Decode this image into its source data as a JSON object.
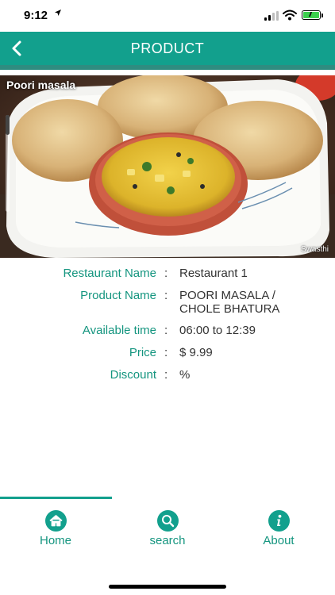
{
  "status_bar": {
    "time": "9:12",
    "location_icon": "location-arrow-icon",
    "signal_icon": "cellular-signal-icon",
    "wifi_icon": "wifi-icon",
    "battery_icon": "battery-charging-icon"
  },
  "header": {
    "title": "PRODUCT",
    "back_icon": "chevron-left-icon"
  },
  "product_image": {
    "overlay_title": "Poori masala",
    "watermark": "Swasthi"
  },
  "details": {
    "separator": ":",
    "restaurant_name": {
      "label": "Restaurant Name",
      "value": "Restaurant 1"
    },
    "product_name": {
      "label": "Product Name",
      "value": "POORI MASALA / CHOLE BHATURA"
    },
    "available_time": {
      "label": "Available time",
      "value": "06:00 to 12:39"
    },
    "price": {
      "label": "Price",
      "value": "$ 9.99"
    },
    "discount": {
      "label": "Discount",
      "value": "%"
    }
  },
  "tabs": [
    {
      "label": "Home",
      "icon": "home-icon"
    },
    {
      "label": "search",
      "icon": "search-icon"
    },
    {
      "label": "About",
      "icon": "info-icon"
    }
  ],
  "colors": {
    "accent": "#12a08d",
    "header_shadow": "#2f8c80",
    "label_text": "#14957f",
    "value_text": "#333333"
  }
}
